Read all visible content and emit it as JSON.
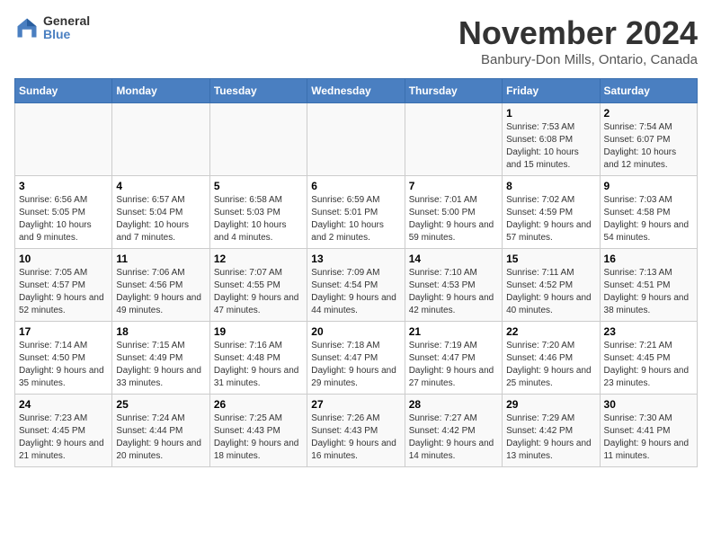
{
  "logo": {
    "general": "General",
    "blue": "Blue"
  },
  "title": "November 2024",
  "subtitle": "Banbury-Don Mills, Ontario, Canada",
  "weekdays": [
    "Sunday",
    "Monday",
    "Tuesday",
    "Wednesday",
    "Thursday",
    "Friday",
    "Saturday"
  ],
  "weeks": [
    [
      {
        "day": "",
        "info": ""
      },
      {
        "day": "",
        "info": ""
      },
      {
        "day": "",
        "info": ""
      },
      {
        "day": "",
        "info": ""
      },
      {
        "day": "",
        "info": ""
      },
      {
        "day": "1",
        "info": "Sunrise: 7:53 AM\nSunset: 6:08 PM\nDaylight: 10 hours and 15 minutes."
      },
      {
        "day": "2",
        "info": "Sunrise: 7:54 AM\nSunset: 6:07 PM\nDaylight: 10 hours and 12 minutes."
      }
    ],
    [
      {
        "day": "3",
        "info": "Sunrise: 6:56 AM\nSunset: 5:05 PM\nDaylight: 10 hours and 9 minutes."
      },
      {
        "day": "4",
        "info": "Sunrise: 6:57 AM\nSunset: 5:04 PM\nDaylight: 10 hours and 7 minutes."
      },
      {
        "day": "5",
        "info": "Sunrise: 6:58 AM\nSunset: 5:03 PM\nDaylight: 10 hours and 4 minutes."
      },
      {
        "day": "6",
        "info": "Sunrise: 6:59 AM\nSunset: 5:01 PM\nDaylight: 10 hours and 2 minutes."
      },
      {
        "day": "7",
        "info": "Sunrise: 7:01 AM\nSunset: 5:00 PM\nDaylight: 9 hours and 59 minutes."
      },
      {
        "day": "8",
        "info": "Sunrise: 7:02 AM\nSunset: 4:59 PM\nDaylight: 9 hours and 57 minutes."
      },
      {
        "day": "9",
        "info": "Sunrise: 7:03 AM\nSunset: 4:58 PM\nDaylight: 9 hours and 54 minutes."
      }
    ],
    [
      {
        "day": "10",
        "info": "Sunrise: 7:05 AM\nSunset: 4:57 PM\nDaylight: 9 hours and 52 minutes."
      },
      {
        "day": "11",
        "info": "Sunrise: 7:06 AM\nSunset: 4:56 PM\nDaylight: 9 hours and 49 minutes."
      },
      {
        "day": "12",
        "info": "Sunrise: 7:07 AM\nSunset: 4:55 PM\nDaylight: 9 hours and 47 minutes."
      },
      {
        "day": "13",
        "info": "Sunrise: 7:09 AM\nSunset: 4:54 PM\nDaylight: 9 hours and 44 minutes."
      },
      {
        "day": "14",
        "info": "Sunrise: 7:10 AM\nSunset: 4:53 PM\nDaylight: 9 hours and 42 minutes."
      },
      {
        "day": "15",
        "info": "Sunrise: 7:11 AM\nSunset: 4:52 PM\nDaylight: 9 hours and 40 minutes."
      },
      {
        "day": "16",
        "info": "Sunrise: 7:13 AM\nSunset: 4:51 PM\nDaylight: 9 hours and 38 minutes."
      }
    ],
    [
      {
        "day": "17",
        "info": "Sunrise: 7:14 AM\nSunset: 4:50 PM\nDaylight: 9 hours and 35 minutes."
      },
      {
        "day": "18",
        "info": "Sunrise: 7:15 AM\nSunset: 4:49 PM\nDaylight: 9 hours and 33 minutes."
      },
      {
        "day": "19",
        "info": "Sunrise: 7:16 AM\nSunset: 4:48 PM\nDaylight: 9 hours and 31 minutes."
      },
      {
        "day": "20",
        "info": "Sunrise: 7:18 AM\nSunset: 4:47 PM\nDaylight: 9 hours and 29 minutes."
      },
      {
        "day": "21",
        "info": "Sunrise: 7:19 AM\nSunset: 4:47 PM\nDaylight: 9 hours and 27 minutes."
      },
      {
        "day": "22",
        "info": "Sunrise: 7:20 AM\nSunset: 4:46 PM\nDaylight: 9 hours and 25 minutes."
      },
      {
        "day": "23",
        "info": "Sunrise: 7:21 AM\nSunset: 4:45 PM\nDaylight: 9 hours and 23 minutes."
      }
    ],
    [
      {
        "day": "24",
        "info": "Sunrise: 7:23 AM\nSunset: 4:45 PM\nDaylight: 9 hours and 21 minutes."
      },
      {
        "day": "25",
        "info": "Sunrise: 7:24 AM\nSunset: 4:44 PM\nDaylight: 9 hours and 20 minutes."
      },
      {
        "day": "26",
        "info": "Sunrise: 7:25 AM\nSunset: 4:43 PM\nDaylight: 9 hours and 18 minutes."
      },
      {
        "day": "27",
        "info": "Sunrise: 7:26 AM\nSunset: 4:43 PM\nDaylight: 9 hours and 16 minutes."
      },
      {
        "day": "28",
        "info": "Sunrise: 7:27 AM\nSunset: 4:42 PM\nDaylight: 9 hours and 14 minutes."
      },
      {
        "day": "29",
        "info": "Sunrise: 7:29 AM\nSunset: 4:42 PM\nDaylight: 9 hours and 13 minutes."
      },
      {
        "day": "30",
        "info": "Sunrise: 7:30 AM\nSunset: 4:41 PM\nDaylight: 9 hours and 11 minutes."
      }
    ]
  ]
}
